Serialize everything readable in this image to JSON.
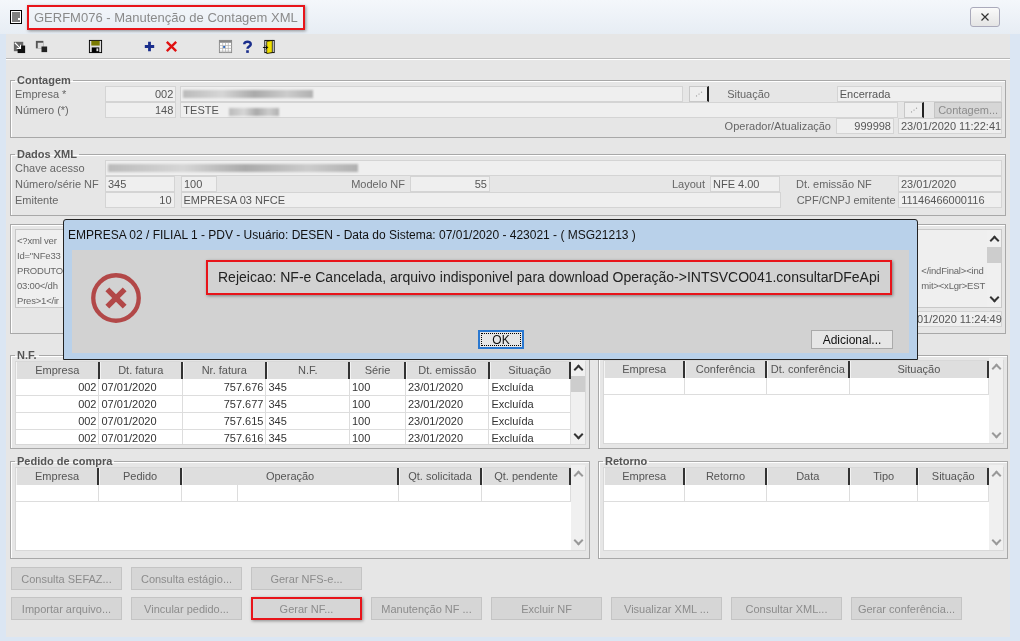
{
  "window": {
    "title": "GERFM076 - Manutenção de Contagem XML",
    "highlighted": true
  },
  "contagem": {
    "title": "Contagem",
    "empresa_label": "Empresa *",
    "empresa": "002",
    "numero_label": "Número (*)",
    "numero": "148",
    "descricao": "TESTE",
    "situacao_label": "Situação",
    "situacao": "Encerrada",
    "contagem_button": {
      "label": "Contagem...",
      "disabled": true
    },
    "operador_label": "Operador/Atualização",
    "operador": "999998",
    "atualizacao": "23/01/2020 11:22:41"
  },
  "dados_xml": {
    "title": "Dados XML",
    "chave_label": "Chave acesso",
    "numero_serie_label": "Número/série NF",
    "numero_nf": "345",
    "serie": "100",
    "modelo_label": "Modelo NF",
    "modelo": "55",
    "layout_label": "Layout",
    "layout": "NFE 4.00",
    "dt_emissao_label": "Dt. emissão NF",
    "dt_emissao": "23/01/2020",
    "emitente_label": "Emitente",
    "emitente_codigo": "10",
    "emitente_nome": "EMPRESA 03 NFCE",
    "cpf_cnpj_label": "CPF/CNPJ emitente",
    "cpf_cnpj": "11146466000116"
  },
  "xml": {
    "lines_left": [
      "<?xml ver",
      "Id=\"NFe33",
      "PRODUTO",
      "03:00</dh",
      "Pres>1</ir"
    ],
    "lines_right": [
      "</indFinal><ind",
      "mit><xLgr>EST"
    ],
    "date": "01/2020 11:24:49"
  },
  "nf": {
    "title": "N.F.",
    "columns": [
      "Empresa",
      "Dt. fatura",
      "Nr. fatura",
      "N.F.",
      "Série",
      "Dt. emissão",
      "Situação"
    ],
    "rows": [
      [
        "002",
        "07/01/2020",
        "757.676",
        "345",
        "100",
        "23/01/2020",
        "Excluída"
      ],
      [
        "002",
        "07/01/2020",
        "757.677",
        "345",
        "100",
        "23/01/2020",
        "Excluída"
      ],
      [
        "002",
        "07/01/2020",
        "757.615",
        "345",
        "100",
        "23/01/2020",
        "Excluída"
      ],
      [
        "002",
        "07/01/2020",
        "757.616",
        "345",
        "100",
        "23/01/2020",
        "Excluída"
      ]
    ]
  },
  "conferencia": {
    "columns": [
      "Empresa",
      "Conferência",
      "Dt. conferência",
      "Situação"
    ]
  },
  "pedido_compra": {
    "title": "Pedido de compra",
    "columns": [
      "Empresa",
      "Pedido",
      "Operação",
      "Qt. solicitada",
      "Qt. pendente"
    ]
  },
  "retorno": {
    "title": "Retorno",
    "columns": [
      "Empresa",
      "Retorno",
      "Data",
      "Tipo",
      "Situação"
    ]
  },
  "buttons": [
    [
      {
        "label": "Consulta SEFAZ...",
        "disabled": true,
        "highlighted": false
      },
      {
        "label": "Consulta estágio...",
        "disabled": true,
        "highlighted": false
      },
      {
        "label": "Gerar NFS-e...",
        "disabled": true,
        "highlighted": false
      }
    ],
    [
      {
        "label": "Importar arquivo...",
        "disabled": true,
        "highlighted": false
      },
      {
        "label": "Vincular pedido...",
        "disabled": true,
        "highlighted": false
      },
      {
        "label": "Gerar NF...",
        "disabled": true,
        "highlighted": true
      },
      {
        "label": "Manutenção NF ...",
        "disabled": true,
        "highlighted": false
      },
      {
        "label": "Excluir NF",
        "disabled": true,
        "highlighted": false
      },
      {
        "label": "Visualizar XML ...",
        "disabled": true,
        "highlighted": false
      },
      {
        "label": "Consultar XML...",
        "disabled": true,
        "highlighted": false
      },
      {
        "label": "Gerar conferência...",
        "disabled": true,
        "highlighted": false
      }
    ]
  ],
  "dialog": {
    "title": "EMPRESA 02 / FILIAL 1 - PDV - Usuário: DESEN - Data do Sistema: 07/01/2020 - 423021 - ( MSG21213 )",
    "message": "Rejeicao: NF-e Cancelada, arquivo indisponivel para download Operação->INTSVCO041.consultarDFeApi",
    "message_highlighted": true,
    "buttons": [
      {
        "label": "OK",
        "focused": true
      },
      {
        "label": "Adicional...",
        "focused": false
      }
    ]
  }
}
